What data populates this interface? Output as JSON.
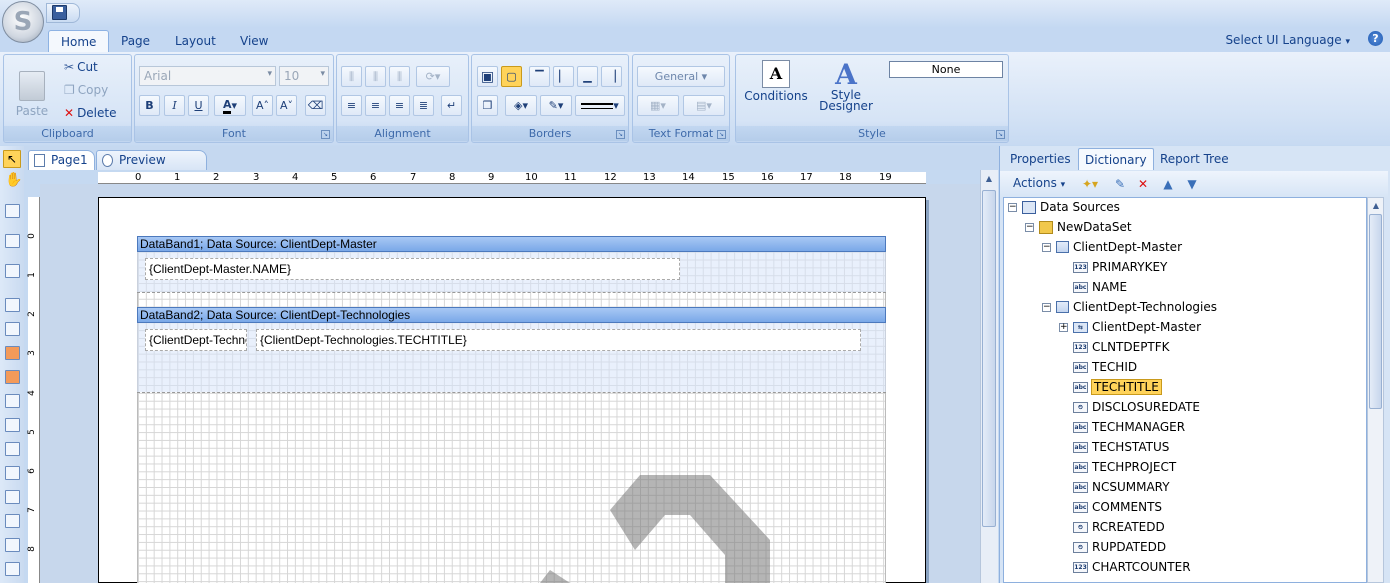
{
  "app": {
    "orb": "S",
    "select_language": "Select UI Language",
    "help": "?"
  },
  "ribbon_tabs": [
    "Home",
    "Page",
    "Layout",
    "View"
  ],
  "ribbon": {
    "clipboard": {
      "label": "Clipboard",
      "paste": "Paste",
      "cut": "Cut",
      "copy": "Copy",
      "delete": "Delete"
    },
    "font": {
      "label": "Font",
      "family": "Arial",
      "size": "10"
    },
    "alignment": {
      "label": "Alignment"
    },
    "borders": {
      "label": "Borders"
    },
    "text_format": {
      "label": "Text Format",
      "format": "General"
    },
    "style": {
      "label": "Style",
      "conditions": "Conditions",
      "style_designer_1": "Style",
      "style_designer_2": "Designer",
      "current_style": "None"
    }
  },
  "doc_tabs": [
    "Page1",
    "Preview"
  ],
  "ruler": [
    "0",
    "1",
    "2",
    "3",
    "4",
    "5",
    "6",
    "7",
    "8",
    "9",
    "10",
    "11",
    "12",
    "13",
    "14",
    "15",
    "16",
    "17",
    "18",
    "19"
  ],
  "vruler": [
    "0",
    "1",
    "2",
    "3",
    "4",
    "5",
    "6",
    "7",
    "8"
  ],
  "report": {
    "band1": {
      "header": "DataBand1; Data Source: ClientDept-Master",
      "field1": "{ClientDept-Master.NAME}"
    },
    "band2": {
      "header": "DataBand2; Data Source: ClientDept-Technologies",
      "field1": "{ClientDept-Technologies.TECHID}",
      "field2": "{ClientDept-Technologies.TECHTITLE}"
    }
  },
  "panel": {
    "tabs": [
      "Properties",
      "Dictionary",
      "Report Tree"
    ],
    "active_tab": "Dictionary",
    "actions": "Actions"
  },
  "tree": [
    {
      "label": "Data Sources",
      "level": 0,
      "icon": "datasources",
      "expanded": true
    },
    {
      "label": "NewDataSet",
      "level": 1,
      "icon": "dataset",
      "expanded": true
    },
    {
      "label": "ClientDept-Master",
      "level": 2,
      "icon": "table",
      "expanded": true
    },
    {
      "label": "PRIMARYKEY",
      "level": 3,
      "icon": "123"
    },
    {
      "label": "NAME",
      "level": 3,
      "icon": "abc"
    },
    {
      "label": "ClientDept-Technologies",
      "level": 2,
      "icon": "table",
      "expanded": true
    },
    {
      "label": "ClientDept-Master",
      "level": 3,
      "icon": "relation",
      "expanded": false
    },
    {
      "label": "CLNTDEPTFK",
      "level": 3,
      "icon": "123"
    },
    {
      "label": "TECHID",
      "level": 3,
      "icon": "abc"
    },
    {
      "label": "TECHTITLE",
      "level": 3,
      "icon": "abc",
      "selected": true
    },
    {
      "label": "DISCLOSUREDATE",
      "level": 3,
      "icon": "date"
    },
    {
      "label": "TECHMANAGER",
      "level": 3,
      "icon": "abc"
    },
    {
      "label": "TECHSTATUS",
      "level": 3,
      "icon": "abc"
    },
    {
      "label": "TECHPROJECT",
      "level": 3,
      "icon": "abc"
    },
    {
      "label": "NCSUMMARY",
      "level": 3,
      "icon": "abc"
    },
    {
      "label": "COMMENTS",
      "level": 3,
      "icon": "abc"
    },
    {
      "label": "RCREATEDD",
      "level": 3,
      "icon": "date"
    },
    {
      "label": "RUPDATEDD",
      "level": 3,
      "icon": "date"
    },
    {
      "label": "CHARTCOUNTER",
      "level": 3,
      "icon": "123"
    }
  ]
}
